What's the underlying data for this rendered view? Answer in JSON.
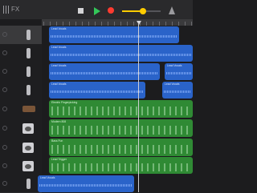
{
  "topbar": {
    "fx_label": "FX"
  },
  "tracks": [
    {
      "name": "audio-track-1",
      "type": "mic",
      "selected": true
    },
    {
      "name": "audio-track-2",
      "type": "mic",
      "selected": false
    },
    {
      "name": "audio-track-3",
      "type": "mic",
      "selected": false
    },
    {
      "name": "audio-track-4",
      "type": "mic",
      "selected": false
    },
    {
      "name": "synth-track",
      "type": "synth",
      "selected": false
    },
    {
      "name": "drum-track-1",
      "type": "drum",
      "selected": false
    },
    {
      "name": "drum-track-2",
      "type": "drum",
      "selected": false
    },
    {
      "name": "drum-track-3",
      "type": "drum",
      "selected": false
    },
    {
      "name": "audio-track-5",
      "type": "mic",
      "selected": false
    }
  ],
  "regions": {
    "r1": "Lead Vocals",
    "r2": "Lead Vocals",
    "r3": "Lead Vocals",
    "r4": "Lead Vocals",
    "r4b": "Lead Vocals",
    "r5": "Lead Vocals",
    "r5b": "Lead Vocals",
    "r6": "Electric Fingerpicking",
    "r7": "Modern 808",
    "r8": "Bass Fun",
    "r9": "Lead Trigger",
    "r10": "Lead Vocals"
  },
  "colors": {
    "audio": "#2a63c9",
    "midi": "#2f8a34",
    "record": "#ff3b30",
    "play": "#33c759",
    "volume": "#ffcc00"
  },
  "volume_level": 0.55
}
